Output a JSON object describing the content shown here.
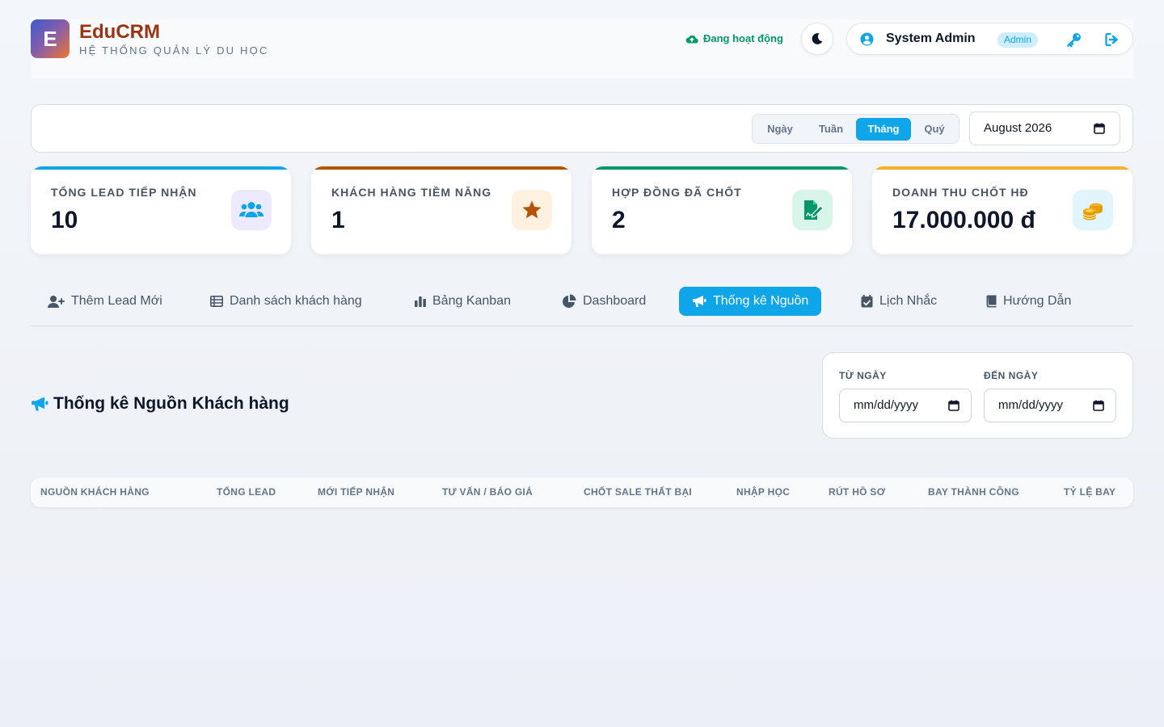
{
  "header": {
    "logo_letter": "E",
    "brand_name": "EduCRM",
    "brand_subtitle": "HỆ THỐNG QUẢN LÝ DU HỌC",
    "status_text": "Đang hoạt động",
    "user_name": "System Admin",
    "user_role": "Admin"
  },
  "filter": {
    "periods": [
      "Ngày",
      "Tuần",
      "Tháng",
      "Quý"
    ],
    "active_period": "Tháng",
    "month_value": "August 2026"
  },
  "stats": [
    {
      "label": "TỔNG LEAD TIẾP NHẬN",
      "value": "10",
      "color": "#0ea5e9",
      "icon": "users-icon"
    },
    {
      "label": "KHÁCH HÀNG TIỀM NĂNG",
      "value": "1",
      "color": "#b45309",
      "icon": "star-icon"
    },
    {
      "label": "HỢP ĐỒNG ĐÃ CHỐT",
      "value": "2",
      "color": "#059669",
      "icon": "signed-contract-icon"
    },
    {
      "label": "DOANH THU CHỐT HĐ",
      "value": "17.000.000 đ",
      "color": "#f59e0b",
      "icon": "coins-icon"
    }
  ],
  "tabs": [
    {
      "label": "Thêm Lead Mới",
      "icon": "user-plus-icon"
    },
    {
      "label": "Danh sách khách hàng",
      "icon": "table-list-icon"
    },
    {
      "label": "Bảng Kanban",
      "icon": "bar-chart-icon"
    },
    {
      "label": "Dashboard",
      "icon": "pie-chart-icon"
    },
    {
      "label": "Thống kê Nguồn",
      "icon": "megaphone-icon"
    },
    {
      "label": "Lịch Nhắc",
      "icon": "calendar-check-icon"
    },
    {
      "label": "Hướng Dẫn",
      "icon": "book-icon"
    }
  ],
  "active_tab": "Thống kê Nguồn",
  "section": {
    "title": "Thống kê Nguồn Khách hàng",
    "from_label": "TỪ NGÀY",
    "to_label": "ĐẾN NGÀY",
    "from_placeholder": "mm/dd/yyyy",
    "to_placeholder": "mm/dd/yyyy"
  },
  "table": {
    "columns": [
      "NGUỒN KHÁCH HÀNG",
      "TỔNG LEAD",
      "MỚI TIẾP NHẬN",
      "TƯ VẤN / BÁO GIÁ",
      "CHỐT SALE THẤT BẠI",
      "NHẬP HỌC",
      "RÚT HỒ SƠ",
      "BAY THÀNH CÔNG",
      "TỶ LỆ BAY"
    ],
    "rows": []
  }
}
